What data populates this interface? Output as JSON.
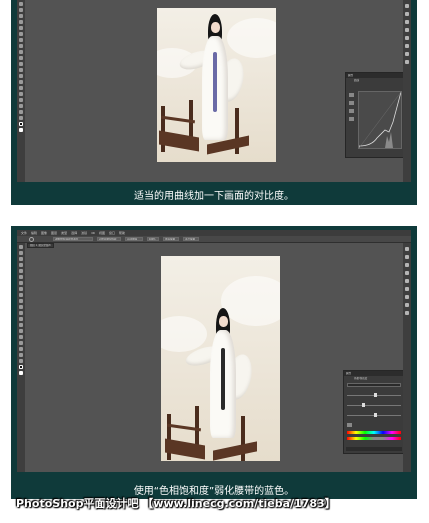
{
  "tutorial_steps": [
    {
      "caption": "适当的用曲线加一下画面的对比度。",
      "panel": {
        "title": "属性",
        "subtitle": "曲线"
      }
    },
    {
      "caption": "使用“色相饱和度”弱化腰带的蓝色。",
      "menu": [
        "文件",
        "编辑",
        "图像",
        "图层",
        "类型",
        "选择",
        "滤镜",
        "3D",
        "视图",
        "窗口",
        "帮助"
      ],
      "options": [
        "调整蒙版/选择并遮住",
        "对所有图层取样",
        "自动增强",
        "100%",
        "填充屏幕",
        "适合屏幕"
      ],
      "document_tab": "图层 1, 图层蒙版/8",
      "panel": {
        "title": "属性",
        "subtitle": "色相/饱和度"
      }
    }
  ],
  "watermark": "PhotoShop平面设计吧 【www.linecg.com/tieba/1783】",
  "colors": {
    "slide_bg": "#0f3a3a",
    "workspace": "#535353",
    "caption_text": "#ffffff"
  }
}
